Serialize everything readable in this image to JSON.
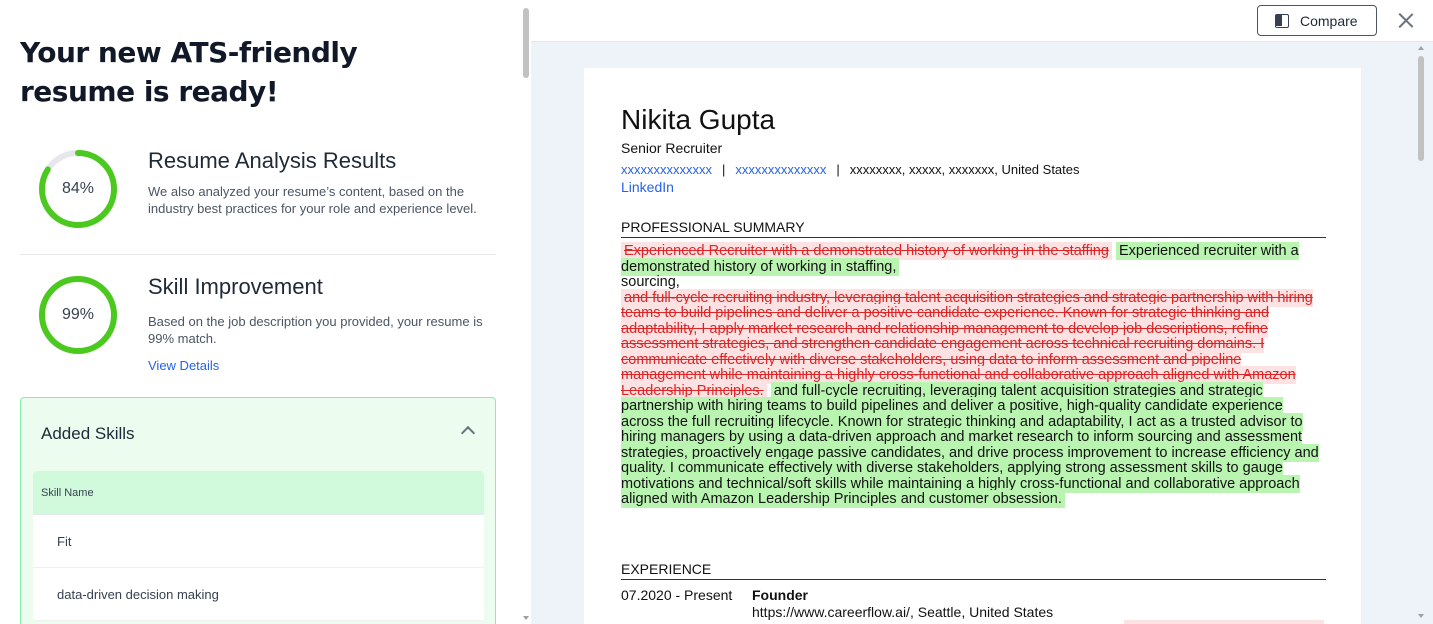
{
  "left": {
    "headline": "Your new ATS-friendly resume is ready!",
    "analysis": {
      "score_label": "84%",
      "score_value": 0.84,
      "title": "Resume Analysis Results",
      "description": "We also analyzed your resume’s content, based on the industry best practices for your role and experience level."
    },
    "skill_improvement": {
      "score_label": "99%",
      "score_value": 0.99,
      "title": "Skill Improvement",
      "description": "Based on the job description you provided, your resume is 99% match.",
      "link": "View Details"
    },
    "added_skills": {
      "title": "Added Skills",
      "column_header": "Skill Name",
      "rows": [
        "Fit",
        "data-driven decision making"
      ]
    }
  },
  "right": {
    "compare_label": "Compare",
    "resume": {
      "name": "Nikita Gupta",
      "title": "Senior Recruiter",
      "contact_email": "xxxxxxxxxxxxxx",
      "contact_phone": "xxxxxxxxxxxxxx",
      "contact_sep1": "|",
      "contact_sep2": "|",
      "contact_location": "xxxxxxxx, xxxxx, xxxxxxx, United States",
      "linkedin": "LinkedIn",
      "summary_heading": "PROFESSIONAL SUMMARY",
      "summary_del_1": "Experienced Recruiter with a demonstrated history of working in the staffing",
      "summary_ins_1": "Experienced recruiter with a demonstrated history of working in staffing,",
      "summary_plain_1": "sourcing,",
      "summary_del_2": "and full-cycle recruiting industry, leveraging talent acquisition strategies and strategic partnership with hiring teams to build pipelines and deliver a positive candidate experience. Known for strategic thinking and adaptability, I apply market research and relationship management to develop job descriptions, refine assessment strategies, and strengthen candidate engagement across technical recruiting domains. I communicate effectively with diverse stakeholders, using data to inform assessment and pipeline management while maintaining a highly cross-functional and collaborative approach aligned with Amazon Leadership Principles.",
      "summary_ins_2": "and full-cycle recruiting, leveraging talent acquisition strategies and strategic partnership with hiring teams to build pipelines and deliver a positive, high-quality candidate experience across the full recruiting lifecycle. Known for strategic thinking and adaptability, I act as a trusted advisor to hiring managers by using a data-driven approach and market research to inform sourcing and assessment strategies, proactively engage passive candidates, and drive process improvement to increase efficiency and quality. I communicate effectively with diverse stakeholders, applying strong assessment skills to gauge motivations and technical/soft skills while maintaining a highly cross-functional and collaborative approach aligned with Amazon Leadership Principles and customer obsession.",
      "experience_heading": "EXPERIENCE",
      "exp_date": "07.2020 - Present",
      "exp_role": "Founder",
      "exp_location": "https://www.careerflow.ai/, Seattle, United States"
    }
  },
  "colors": {
    "ring_green": "#4cc91f",
    "ring_track": "#e5e7eb",
    "deleted_bg": "#fde2e4",
    "deleted_text": "#dc2626",
    "inserted_bg": "#b9f5b0",
    "link_blue": "#2563eb",
    "panel_bg": "#eef2f9"
  },
  "icons": {
    "compare": "compare-icon",
    "close": "close-icon",
    "collapse": "chevron-up-icon"
  }
}
